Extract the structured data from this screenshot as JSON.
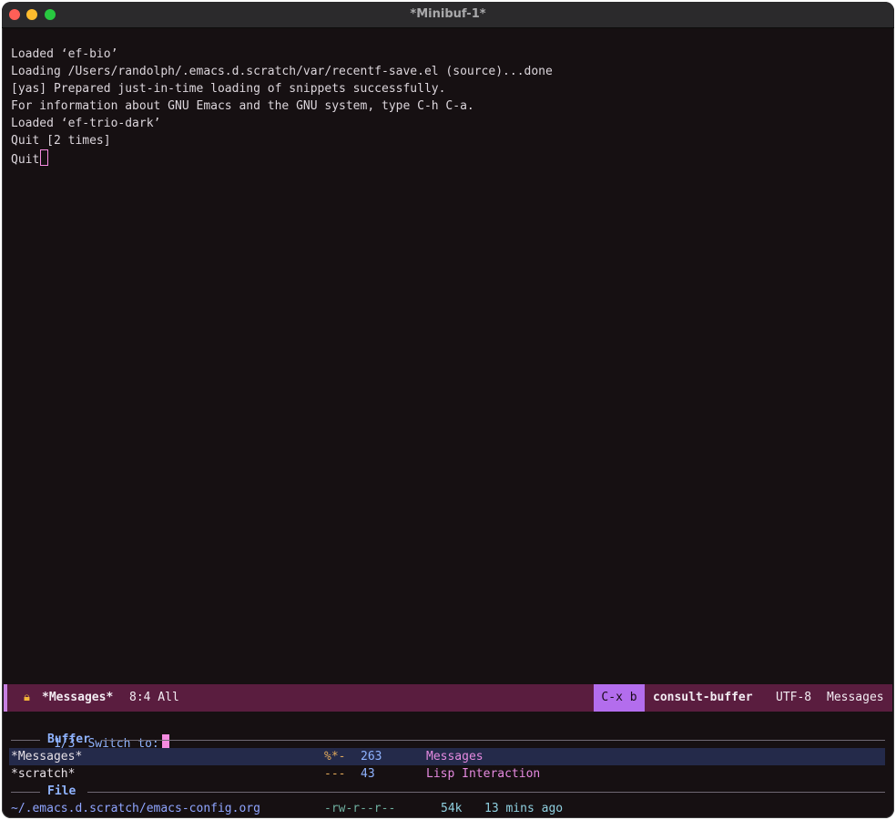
{
  "window": {
    "title": "*Minibuf-1*"
  },
  "messages": [
    "Loaded ‘ef-bio’",
    "Loading /Users/randolph/.emacs.d.scratch/var/recentf-save.el (source)...done",
    "[yas] Prepared just-in-time loading of snippets successfully.",
    "For information about GNU Emacs and the GNU system, type C-h C-a.",
    "Loaded ‘ef-trio-dark’",
    "Quit [2 times]",
    "Quit"
  ],
  "modeline": {
    "lock_icon": "lock-icon",
    "buffer_name": "*Messages*",
    "position": "8:4 All",
    "keys": "C-x b",
    "command": "consult-buffer",
    "encoding": "UTF-8",
    "major_mode": "Messages",
    "colors": {
      "background": "#5a1d3f",
      "keys_bg": "#b36ded",
      "accent_bar": "#c77fe0"
    }
  },
  "minibuffer": {
    "count": "1/3",
    "prompt": "Switch to:",
    "input": "",
    "groups": [
      {
        "title": "Buffer",
        "items": [
          {
            "name": "*Messages*",
            "modified": "%*-",
            "size": "263",
            "mode": "Messages",
            "selected": true
          },
          {
            "name": "*scratch*",
            "modified": "---",
            "size": "43",
            "mode": "Lisp Interaction",
            "selected": false
          }
        ]
      },
      {
        "title": "File",
        "items": [
          {
            "path": "~/.emacs.d.scratch/emacs-config.org",
            "perms": "-rw-r--r--",
            "size": "54k",
            "age": "13 mins ago"
          }
        ]
      }
    ]
  }
}
